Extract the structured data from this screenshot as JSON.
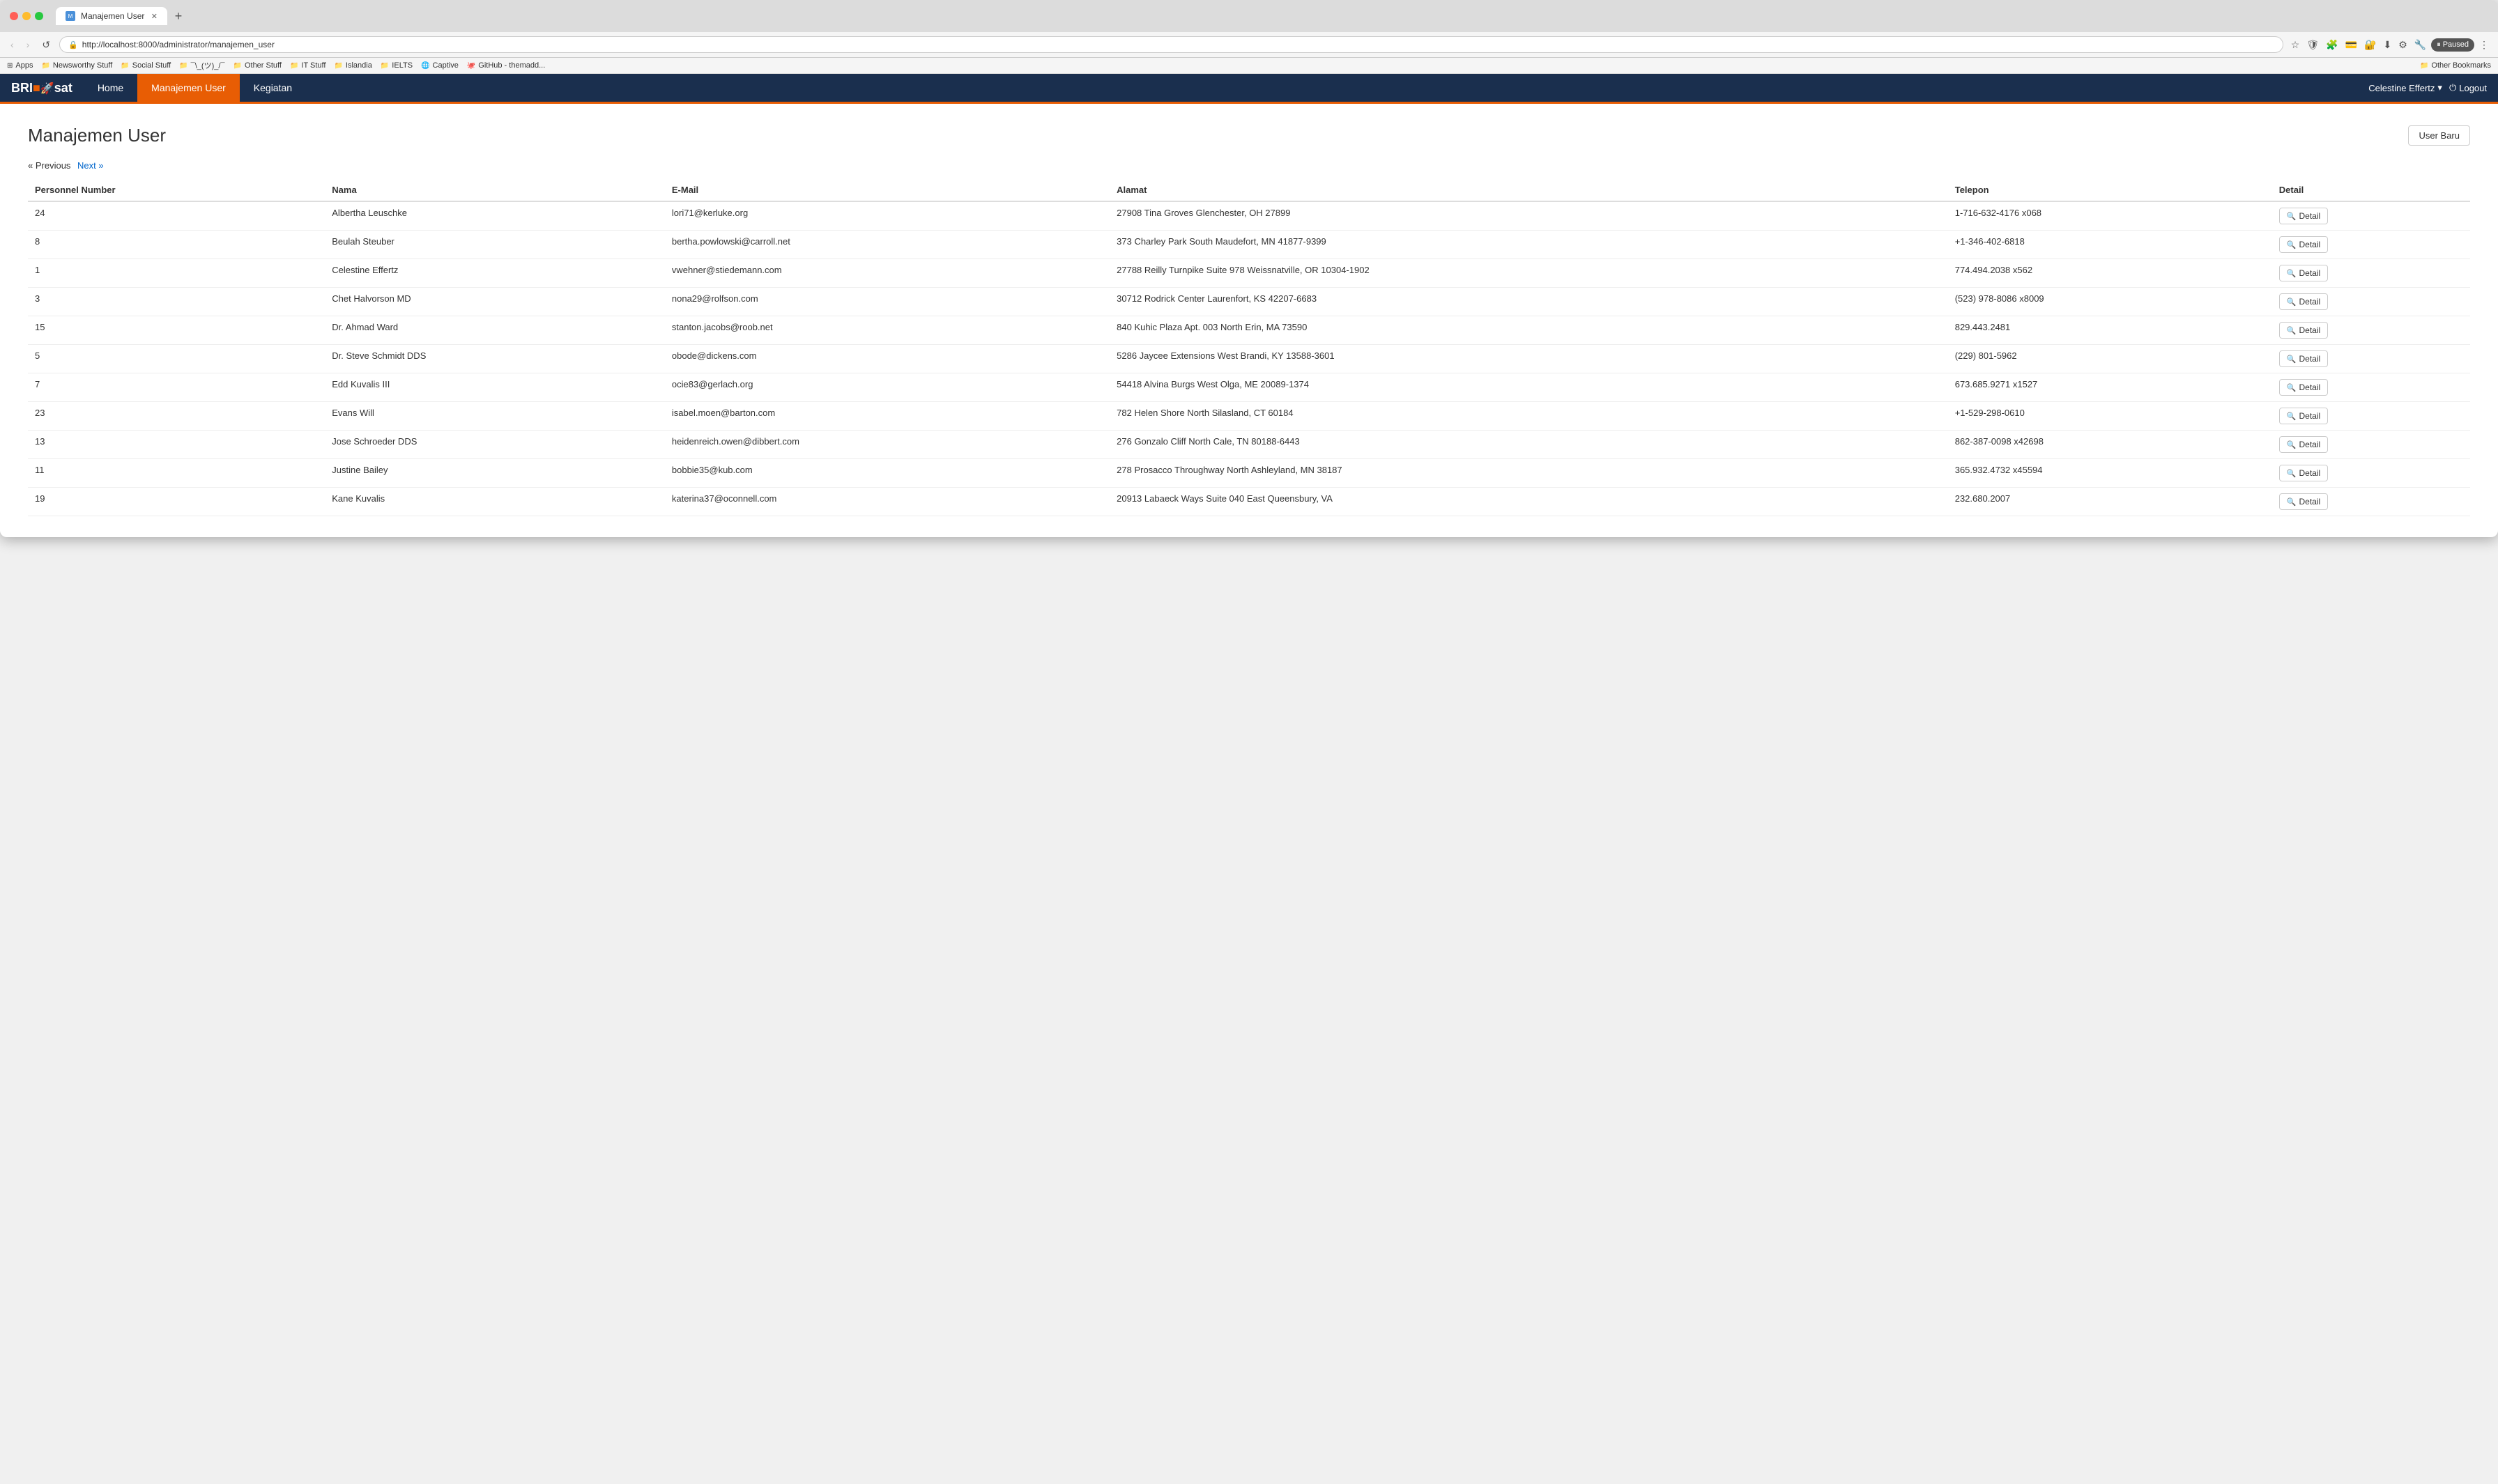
{
  "browser": {
    "tab_title": "Manajemen User",
    "url": "http://localhost:8000/administrator/manajemen_user",
    "new_tab_label": "+",
    "nav_back": "‹",
    "nav_forward": "›",
    "nav_refresh": "↺",
    "paused_label": "Paused",
    "bookmarks": [
      {
        "label": "Apps",
        "icon": "⊞"
      },
      {
        "label": "Newsworthy Stuff",
        "icon": "📁"
      },
      {
        "label": "Social Stuff",
        "icon": "📁"
      },
      {
        "label": "¯\\_(ツ)_/¯",
        "icon": "📁"
      },
      {
        "label": "Other Stuff",
        "icon": "📁"
      },
      {
        "label": "IT Stuff",
        "icon": "📁"
      },
      {
        "label": "Islandia",
        "icon": "📁"
      },
      {
        "label": "IELTS",
        "icon": "📁"
      },
      {
        "label": "Captive",
        "icon": "🌐"
      },
      {
        "label": "GitHub - themadd...",
        "icon": "🐙"
      }
    ],
    "other_bookmarks": "Other Bookmarks"
  },
  "nav": {
    "brand": "BRI",
    "brand_sub": "sat",
    "home_label": "Home",
    "manajemen_label": "Manajemen User",
    "kegiatan_label": "Kegiatan",
    "user_label": "Celestine Effertz",
    "logout_label": "Logout"
  },
  "page": {
    "title": "Manajemen User",
    "user_baru_label": "User Baru",
    "prev_label": "« Previous",
    "next_label": "Next »",
    "columns": {
      "personnel_number": "Personnel Number",
      "nama": "Nama",
      "email": "E-Mail",
      "alamat": "Alamat",
      "telepon": "Telepon",
      "detail": "Detail"
    },
    "detail_btn": "Detail",
    "rows": [
      {
        "id": 24,
        "nama": "Albertha Leuschke",
        "email": "lori71@kerluke.org",
        "alamat": "27908 Tina Groves Glenchester, OH 27899",
        "telepon": "1-716-632-4176 x068"
      },
      {
        "id": 8,
        "nama": "Beulah Steuber",
        "email": "bertha.powlowski@carroll.net",
        "alamat": "373 Charley Park South Maudefort, MN 41877-9399",
        "telepon": "+1-346-402-6818"
      },
      {
        "id": 1,
        "nama": "Celestine Effertz",
        "email": "vwehner@stiedemann.com",
        "alamat": "27788 Reilly Turnpike Suite 978 Weissnatville, OR 10304-1902",
        "telepon": "774.494.2038 x562"
      },
      {
        "id": 3,
        "nama": "Chet Halvorson MD",
        "email": "nona29@rolfson.com",
        "alamat": "30712 Rodrick Center Laurenfort, KS 42207-6683",
        "telepon": "(523) 978-8086 x8009"
      },
      {
        "id": 15,
        "nama": "Dr. Ahmad Ward",
        "email": "stanton.jacobs@roob.net",
        "alamat": "840 Kuhic Plaza Apt. 003 North Erin, MA 73590",
        "telepon": "829.443.2481"
      },
      {
        "id": 5,
        "nama": "Dr. Steve Schmidt DDS",
        "email": "obode@dickens.com",
        "alamat": "5286 Jaycee Extensions West Brandi, KY 13588-3601",
        "telepon": "(229) 801-5962"
      },
      {
        "id": 7,
        "nama": "Edd Kuvalis III",
        "email": "ocie83@gerlach.org",
        "alamat": "54418 Alvina Burgs West Olga, ME 20089-1374",
        "telepon": "673.685.9271 x1527"
      },
      {
        "id": 23,
        "nama": "Evans Will",
        "email": "isabel.moen@barton.com",
        "alamat": "782 Helen Shore North Silasland, CT 60184",
        "telepon": "+1-529-298-0610"
      },
      {
        "id": 13,
        "nama": "Jose Schroeder DDS",
        "email": "heidenreich.owen@dibbert.com",
        "alamat": "276 Gonzalo Cliff North Cale, TN 80188-6443",
        "telepon": "862-387-0098 x42698"
      },
      {
        "id": 11,
        "nama": "Justine Bailey",
        "email": "bobbie35@kub.com",
        "alamat": "278 Prosacco Throughway North Ashleyland, MN 38187",
        "telepon": "365.932.4732 x45594"
      },
      {
        "id": 19,
        "nama": "Kane Kuvalis",
        "email": "katerina37@oconnell.com",
        "alamat": "20913 Labaeck Ways Suite 040 East Queensbury, VA",
        "telepon": "232.680.2007"
      }
    ]
  }
}
